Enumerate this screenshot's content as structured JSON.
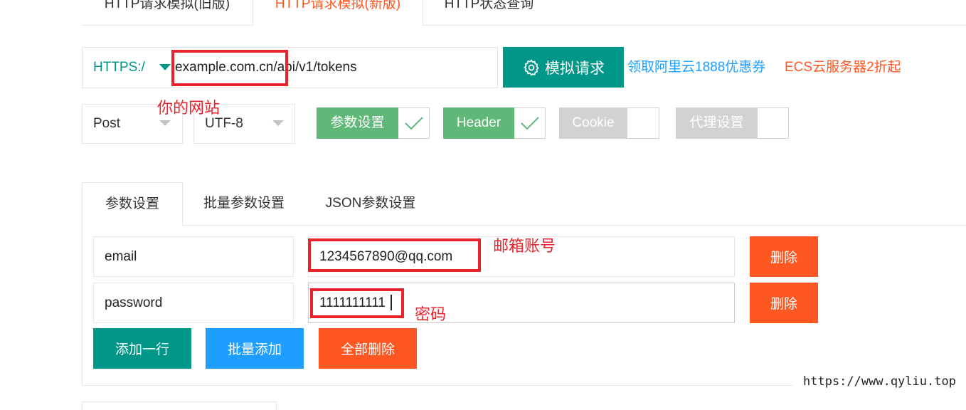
{
  "top_tabs": {
    "items": [
      {
        "label": "HTTP请求模拟(旧版)"
      },
      {
        "label": "HTTP请求模拟(新版)"
      },
      {
        "label": "HTTP状态查询"
      }
    ]
  },
  "url_bar": {
    "protocol": "HTTPS:/",
    "url": "example.com.cn/api/v1/tokens",
    "submit_label": "模拟请求",
    "submit_icon": "gear-icon"
  },
  "promo": {
    "text1": "领取阿里云1888优惠券",
    "text2": "ECS云服务器2折起"
  },
  "selects": {
    "method": "Post",
    "charset": "UTF-8"
  },
  "switches": [
    {
      "label": "参数设置",
      "on": true
    },
    {
      "label": "Header",
      "on": true
    },
    {
      "label": "Cookie",
      "on": false
    },
    {
      "label": "代理设置",
      "on": false
    }
  ],
  "param_tabs": {
    "items": [
      {
        "label": "参数设置"
      },
      {
        "label": "批量参数设置"
      },
      {
        "label": "JSON参数设置"
      }
    ]
  },
  "params": [
    {
      "key": "email",
      "value": "1234567890@qq.com",
      "delete_label": "删除"
    },
    {
      "key": "password",
      "value": "1111111111",
      "delete_label": "删除"
    }
  ],
  "actions": {
    "add_row": "添加一行",
    "batch_add": "批量添加",
    "delete_all": "全部删除"
  },
  "annotations": {
    "site": "你的网站",
    "email": "邮箱账号",
    "password": "密码"
  },
  "watermark": "https://www.qyliu.top",
  "colors": {
    "primary": "#009688",
    "danger": "#ff5722",
    "blue": "#1e9fff",
    "switch_on": "#5fb878",
    "switch_off": "#d2d2d2",
    "annotation": "#e8232c"
  }
}
